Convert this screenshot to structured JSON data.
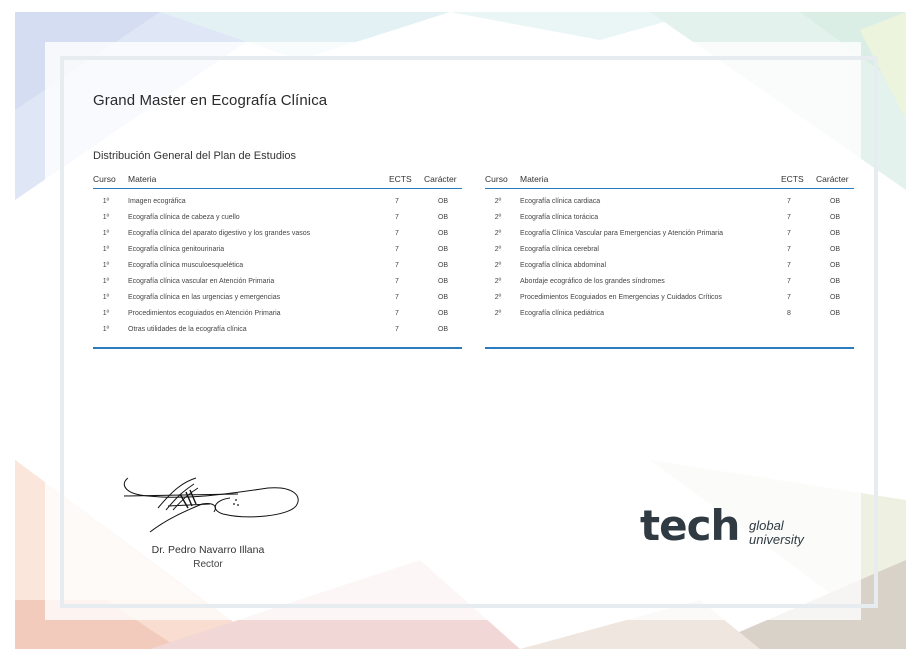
{
  "header": {
    "title": "Grand Master  en Ecografía Clínica",
    "subtitle": "Distribución General del Plan de Estudios"
  },
  "table_headers": {
    "curso": "Curso",
    "materia": "Materia",
    "ects": "ECTS",
    "caracter": "Carácter"
  },
  "left_table": [
    {
      "curso": "1º",
      "materia": "Imagen ecográfica",
      "ects": "7",
      "caracter": "OB"
    },
    {
      "curso": "1º",
      "materia": "Ecografía clínica de cabeza y cuello",
      "ects": "7",
      "caracter": "OB"
    },
    {
      "curso": "1º",
      "materia": "Ecografía clínica del aparato digestivo y los grandes vasos",
      "ects": "7",
      "caracter": "OB"
    },
    {
      "curso": "1º",
      "materia": "Ecografía clínica genitourinaria",
      "ects": "7",
      "caracter": "OB"
    },
    {
      "curso": "1º",
      "materia": "Ecografía clínica musculoesquelética",
      "ects": "7",
      "caracter": "OB"
    },
    {
      "curso": "1º",
      "materia": "Ecografía clínica vascular en Atención Primaria",
      "ects": "7",
      "caracter": "OB"
    },
    {
      "curso": "1º",
      "materia": "Ecografía clínica en las urgencias y emergencias",
      "ects": "7",
      "caracter": "OB"
    },
    {
      "curso": "1º",
      "materia": "Procedimientos ecoguiados en Atención Primaria",
      "ects": "7",
      "caracter": "OB"
    },
    {
      "curso": "1º",
      "materia": "Otras utilidades de la ecografía clínica",
      "ects": "7",
      "caracter": "OB"
    }
  ],
  "right_table": [
    {
      "curso": "2º",
      "materia": "Ecografía clínica cardiaca",
      "ects": "7",
      "caracter": "OB"
    },
    {
      "curso": "2º",
      "materia": "Ecografía clínica torácica",
      "ects": "7",
      "caracter": "OB"
    },
    {
      "curso": "2º",
      "materia": "Ecografía Clínica Vascular para Emergencias y Atención Primaria",
      "ects": "7",
      "caracter": "OB"
    },
    {
      "curso": "2º",
      "materia": "Ecografía clínica cerebral",
      "ects": "7",
      "caracter": "OB"
    },
    {
      "curso": "2º",
      "materia": "Ecografía clínica abdominal",
      "ects": "7",
      "caracter": "OB"
    },
    {
      "curso": "2º",
      "materia": "Abordaje ecográfico de los grandes síndromes",
      "ects": "7",
      "caracter": "OB"
    },
    {
      "curso": "2º",
      "materia": "Procedimientos Ecoguiados en Emergencias y Cuidados Críticos",
      "ects": "7",
      "caracter": "OB"
    },
    {
      "curso": "2º",
      "materia": "Ecografía clínica pediátrica",
      "ects": "8",
      "caracter": "OB"
    }
  ],
  "signature": {
    "name": "Dr. Pedro Navarro Illana",
    "role": "Rector"
  },
  "logo": {
    "wordmark": "tech",
    "line1": "global",
    "line2": "university"
  },
  "colors": {
    "accent": "#2b7bbf",
    "logo_dark": "#2f3a42"
  }
}
